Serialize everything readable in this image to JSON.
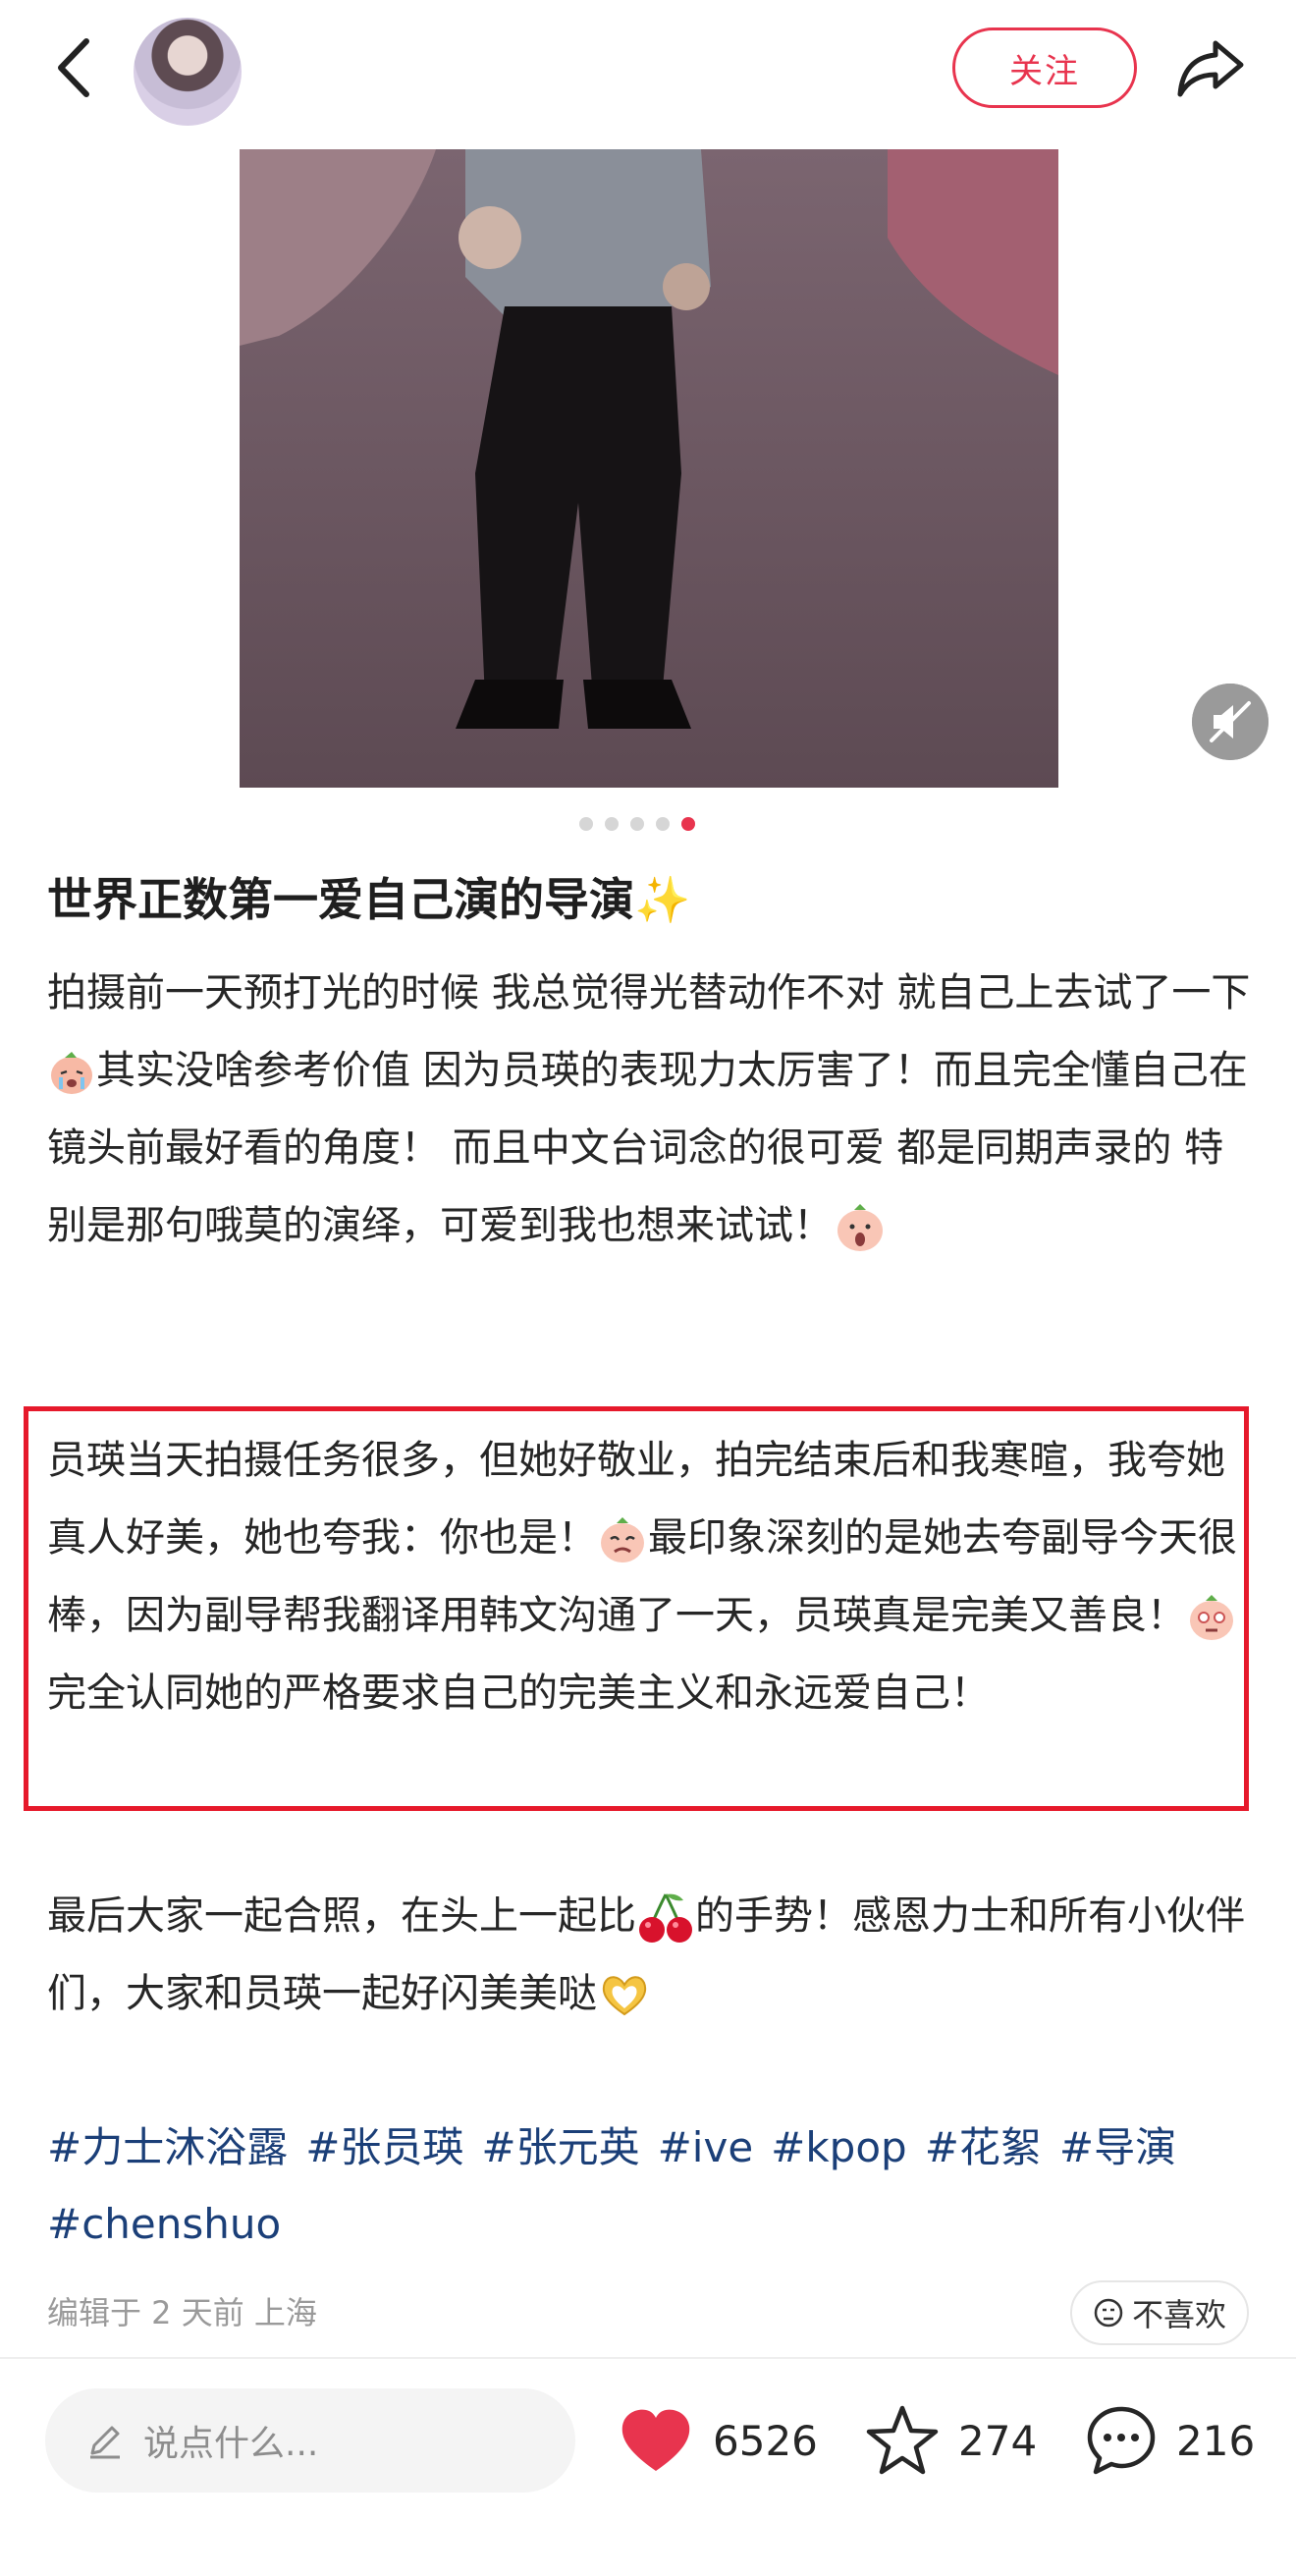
{
  "header": {
    "follow_label": "关注",
    "icons": [
      "back-icon",
      "share-icon"
    ]
  },
  "carousel": {
    "total": 5,
    "active_index": 4,
    "sound_icon": "mute-speaker-icon"
  },
  "post": {
    "title": "世界正数第一爱自己演的导演✨",
    "paragraph1": {
      "a": "拍摄前一天预打光的时候 我总觉得光替动作不对 就自己上去试了一下",
      "b": "其实没啥参考价值 因为员瑛的表现力太厉害了！而且完全懂自己在镜头前最好看的角度！ 而且中文台词念的很可爱 都是同期声录的 特别是那句哦莫的演绎，可爱到我也想来试试！"
    },
    "paragraph2": {
      "a": "员瑛当天拍摄任务很多，但她好敬业，拍完结束后和我寒暄，我夸她真人好美，她也夸我：你也是！",
      "b": "最印象深刻的是她去夸副导今天很棒，因为副导帮我翻译用韩文沟通了一天，员瑛真是完美又善良！",
      "c": "完全认同她的严格要求自己的完美主义和永远爱自己！"
    },
    "paragraph3": {
      "a": "最后大家一起合照，在头上一起比",
      "b": "的手势！感恩力士和所有小伙伴们，大家和员瑛一起好闪美美哒"
    },
    "tags": [
      "#力士沐浴露",
      "#张员瑛",
      "#张元英",
      "#ive",
      "#kpop",
      "#花絮",
      "#导演",
      "#chenshuo"
    ],
    "meta": "编辑于 2 天前 上海",
    "dislike_label": "不喜欢"
  },
  "footer": {
    "comment_placeholder": "说点什么...",
    "likes": "6526",
    "favorites": "274",
    "comments": "216"
  },
  "colors": {
    "accent": "#e8344e",
    "tag": "#1b3f78",
    "highlight_border": "#e6192b"
  }
}
